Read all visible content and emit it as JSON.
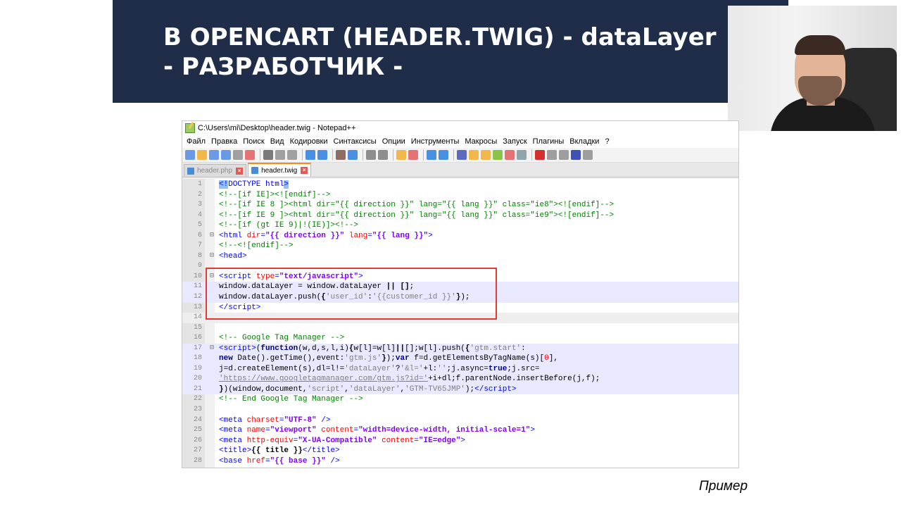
{
  "slide": {
    "title_line1": "В OPENCART (HEADER.TWIG) - dataLayer",
    "title_line2": "- РАЗРАБОТЧИК -",
    "caption": "Пример"
  },
  "window": {
    "title": "C:\\Users\\mi\\Desktop\\header.twig - Notepad++"
  },
  "menu": [
    "Файл",
    "Правка",
    "Поиск",
    "Вид",
    "Кодировки",
    "Синтаксисы",
    "Опции",
    "Инструменты",
    "Макросы",
    "Запуск",
    "Плагины",
    "Вкладки",
    "?"
  ],
  "tabs": [
    {
      "label": "header.php",
      "active": false
    },
    {
      "label": "header.twig",
      "active": true
    }
  ],
  "code_lines": [
    {
      "n": "1",
      "fold": "",
      "html": "<span class=\"c-tag c-doct\">&lt;!</span><span class=\"c-tag\">DOCTYPE html</span><span class=\"c-tag c-doct\">&gt;</span>"
    },
    {
      "n": "2",
      "fold": "",
      "html": "<span class=\"c-com\">&lt;!--[if IE]&gt;&lt;![endif]--&gt;</span>"
    },
    {
      "n": "3",
      "fold": "",
      "html": "<span class=\"c-com\">&lt;!--[if IE 8 ]&gt;&lt;html dir=\"{{ direction }}\" lang=\"{{ lang }}\" class=\"ie8\"&gt;&lt;![endif]--&gt;</span>"
    },
    {
      "n": "4",
      "fold": "",
      "html": "<span class=\"c-com\">&lt;!--[if IE 9 ]&gt;&lt;html dir=\"{{ direction }}\" lang=\"{{ lang }}\" class=\"ie9\"&gt;&lt;![endif]--&gt;</span>"
    },
    {
      "n": "5",
      "fold": "",
      "html": "<span class=\"c-com\">&lt;!--[if (gt IE 9)|!(IE)]&gt;&lt;!--&gt;</span>"
    },
    {
      "n": "6",
      "fold": "⊟",
      "html": "<span class=\"c-tag\">&lt;html </span><span class=\"c-attr\">dir</span><span class=\"c-tag\">=</span><span class=\"c-str\">\"{{ direction }}\"</span><span class=\"c-tag\"> </span><span class=\"c-attr\">lang</span><span class=\"c-tag\">=</span><span class=\"c-str\">\"{{ lang }}\"</span><span class=\"c-tag\">&gt;</span>"
    },
    {
      "n": "7",
      "fold": "",
      "html": "<span class=\"c-com\">&lt;!--&lt;![endif]--&gt;</span>"
    },
    {
      "n": "8",
      "fold": "⊟",
      "html": "<span class=\"c-tag\">&lt;head&gt;</span>"
    },
    {
      "n": "9",
      "fold": "",
      "html": ""
    },
    {
      "n": "10",
      "fold": "⊟",
      "html": "<span class=\"c-tag\">&lt;script </span><span class=\"c-attr\">type</span><span class=\"c-tag\">=</span><span class=\"c-str\">\"text/javascript\"</span><span class=\"c-tag\">&gt;</span>"
    },
    {
      "n": "11",
      "fold": "",
      "hl": true,
      "html": "window.dataLayer = window.dataLayer <b>||</b> <b>[]</b>;"
    },
    {
      "n": "12",
      "fold": "",
      "hl": true,
      "html": "window.dataLayer.push(<b>{</b><span class=\"c-jstr\">'user_id'</span>:<span class=\"c-jstr\">'{{customer_id }}'</span><b>}</b>);"
    },
    {
      "n": "13",
      "fold": "",
      "html": "<span class=\"c-tag\">&lt;/script&gt;</span>"
    },
    {
      "n": "14",
      "fold": "",
      "cur": true,
      "html": ""
    },
    {
      "n": "15",
      "fold": "",
      "html": ""
    },
    {
      "n": "16",
      "fold": "",
      "html": "<span class=\"c-com\">&lt;!-- Google Tag Manager --&gt;</span>"
    },
    {
      "n": "17",
      "fold": "⊟",
      "hl": true,
      "html": "<span class=\"c-tag\">&lt;script&gt;</span>(<span class=\"c-kw\">function</span>(w,d,s,l,i)<b>{</b>w[l]=w[l]<b>||</b>[];w[l].push(<b>{</b><span class=\"c-jstr\">'gtm.start'</span>:"
    },
    {
      "n": "18",
      "fold": "",
      "hl": true,
      "html": "<span class=\"c-kw\">new</span> Date().getTime(),event:<span class=\"c-jstr\">'gtm.js'</span><b>}</b>);<span class=\"c-kw\">var</span> f=d.getElementsByTagName(s)[<span class=\"c-num\">0</span>],"
    },
    {
      "n": "19",
      "fold": "",
      "hl": true,
      "html": "j=d.createElement(s),dl=l!=<span class=\"c-jstr\">'dataLayer'</span>?<span class=\"c-jstr\">'&amp;l='</span>+l:<span class=\"c-jstr\">''</span>;j.async=<span class=\"c-kw\">true</span>;j.src="
    },
    {
      "n": "20",
      "fold": "",
      "hl": true,
      "html": "<span class=\"c-jstr\"><u>'https://www.googletagmanager.com/gtm.js?id='</u></span>+i+dl;f.parentNode.insertBefore(j,f);"
    },
    {
      "n": "21",
      "fold": "",
      "hl": true,
      "html": "<b>}</b>)(window,document,<span class=\"c-jstr\">'script'</span>,<span class=\"c-jstr\">'dataLayer'</span>,<span class=\"c-jstr\">'GTM-TV65JMP'</span>);<span class=\"c-tag\">&lt;/script&gt;</span>"
    },
    {
      "n": "22",
      "fold": "",
      "html": "<span class=\"c-com\">&lt;!-- End Google Tag Manager --&gt;</span>"
    },
    {
      "n": "23",
      "fold": "",
      "html": ""
    },
    {
      "n": "24",
      "fold": "",
      "html": "<span class=\"c-tag\">&lt;meta </span><span class=\"c-attr\">charset</span><span class=\"c-tag\">=</span><span class=\"c-str\">\"UTF-8\"</span><span class=\"c-tag\"> /&gt;</span>"
    },
    {
      "n": "25",
      "fold": "",
      "html": "<span class=\"c-tag\">&lt;meta </span><span class=\"c-attr\">name</span><span class=\"c-tag\">=</span><span class=\"c-str\">\"viewport\"</span><span class=\"c-tag\"> </span><span class=\"c-attr\">content</span><span class=\"c-tag\">=</span><span class=\"c-str\">\"width=device-width, initial-scale=1\"</span><span class=\"c-tag\">&gt;</span>"
    },
    {
      "n": "26",
      "fold": "",
      "html": "<span class=\"c-tag\">&lt;meta </span><span class=\"c-attr\">http-equiv</span><span class=\"c-tag\">=</span><span class=\"c-str\">\"X-UA-Compatible\"</span><span class=\"c-tag\"> </span><span class=\"c-attr\">content</span><span class=\"c-tag\">=</span><span class=\"c-str\">\"IE=edge\"</span><span class=\"c-tag\">&gt;</span>"
    },
    {
      "n": "27",
      "fold": "",
      "html": "<span class=\"c-tag\">&lt;title&gt;</span><b>{{ title }}</b><span class=\"c-tag\">&lt;/title&gt;</span>"
    },
    {
      "n": "28",
      "fold": "",
      "html": "<span class=\"c-tag\">&lt;base </span><span class=\"c-attr\">href</span><span class=\"c-tag\">=</span><span class=\"c-str\">\"{{ base }}\"</span><span class=\"c-tag\"> /&gt;</span>"
    }
  ],
  "colors": {
    "banner_bg": "#1f2d48",
    "highlight_box": "#e53935",
    "active_tab_accent": "#fa8c16"
  }
}
